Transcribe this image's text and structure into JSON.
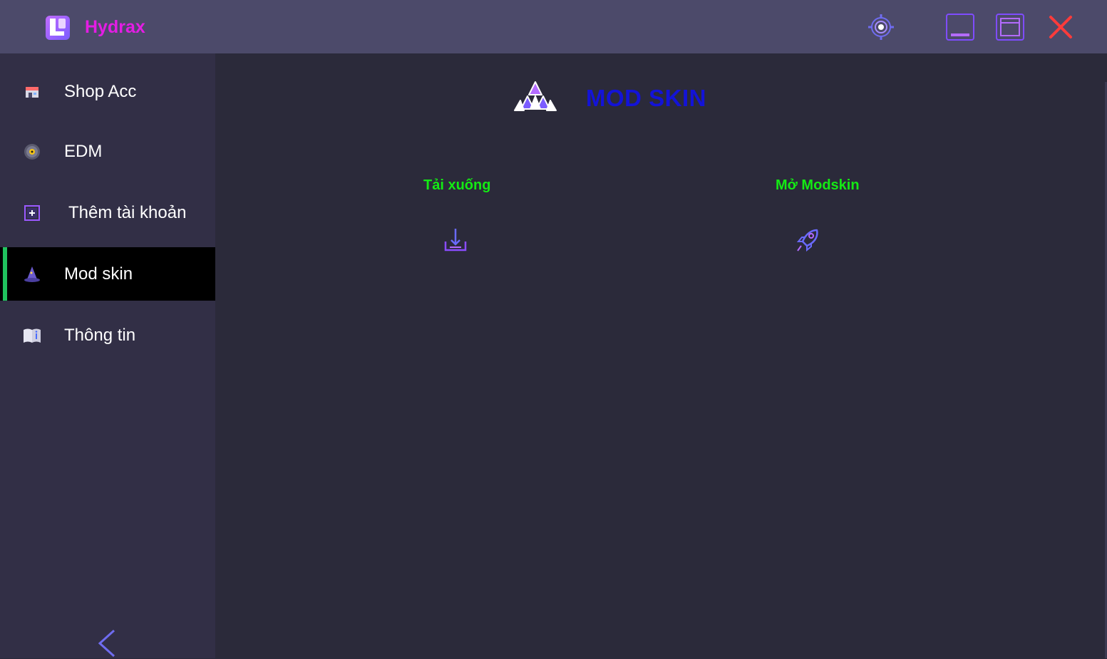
{
  "app": {
    "title": "Hydrax",
    "title_color": "#e41de4",
    "logo_icon": "app-logo-icon"
  },
  "titlebar": {
    "buttons": [
      {
        "name": "settings",
        "icon": "gear-icon"
      },
      {
        "name": "minimize",
        "icon": "minimize-icon"
      },
      {
        "name": "maximize",
        "icon": "maximize-icon"
      },
      {
        "name": "close",
        "icon": "close-icon",
        "color": "#ff3b3b"
      }
    ]
  },
  "sidebar": {
    "items": [
      {
        "label": "Shop Acc",
        "icon": "shop-icon",
        "active": false
      },
      {
        "label": "EDM",
        "icon": "music-disc-icon",
        "active": false
      },
      {
        "label": "Thêm tài khoản",
        "icon": "add-account-icon",
        "active": false
      },
      {
        "label": "Mod skin",
        "icon": "wizard-hat-icon",
        "active": true
      },
      {
        "label": "Thông tin",
        "icon": "info-book-icon",
        "active": false
      }
    ],
    "active_accent": "#20c35e",
    "collapse_icon": "chevron-left-icon"
  },
  "main": {
    "title": "MOD SKIN",
    "title_color": "#1313d8",
    "title_icon": "triangles-icon",
    "actions": [
      {
        "label": "Tải xuống",
        "icon": "download-icon"
      },
      {
        "label": "Mở Modskin",
        "icon": "rocket-icon"
      }
    ],
    "action_label_color": "#14ea14"
  }
}
